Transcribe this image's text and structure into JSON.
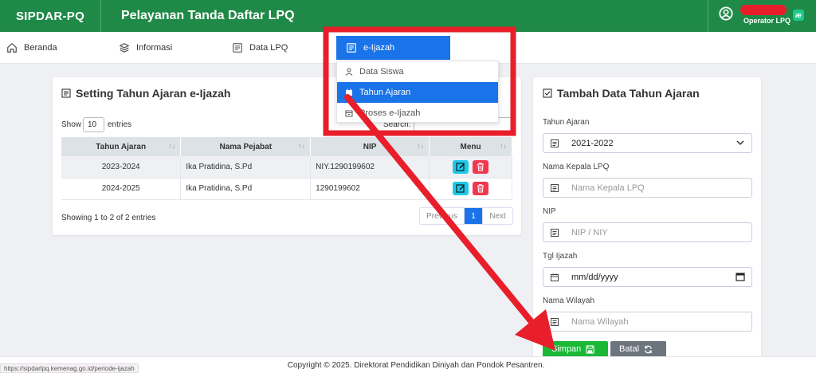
{
  "header": {
    "brand": "SIPDAR-PQ",
    "title": "Pelayanan Tanda Daftar LPQ",
    "user_role": "Operator LPQ",
    "badge": "æ"
  },
  "nav": {
    "items": [
      {
        "label": "Beranda",
        "icon": "home-icon"
      },
      {
        "label": "Informasi",
        "icon": "layers-icon"
      },
      {
        "label": "Data LPQ",
        "icon": "document-icon"
      }
    ]
  },
  "dropdown": {
    "header": "e-Ijazah",
    "items": [
      {
        "label": "Data Siswa",
        "icon": "person-icon"
      },
      {
        "label": "Tahun Ajaran",
        "icon": "calendar-icon"
      },
      {
        "label": "Proses e-Ijazah",
        "icon": "archive-icon"
      }
    ]
  },
  "settings": {
    "title": "Setting Tahun Ajaran e-Ijazah",
    "show_label": "Show",
    "show_value": "10",
    "entries_label": "entries",
    "search_label": "Search:",
    "columns": [
      "Tahun Ajaran",
      "Nama Pejabat",
      "NIP",
      "Menu"
    ],
    "rows": [
      {
        "tahun": "2023-2024",
        "pejabat": "Ika Pratidina, S.Pd",
        "nip": "NIY.1290199602"
      },
      {
        "tahun": "2024-2025",
        "pejabat": "Ika Pratidina, S.Pd",
        "nip": "1290199602"
      }
    ],
    "showing": "Showing 1 to 2 of 2 entries",
    "pager": {
      "prev": "Previous",
      "current": "1",
      "next": "Next"
    }
  },
  "form": {
    "title": "Tambah Data Tahun Ajaran",
    "tahun_label": "Tahun Ajaran",
    "tahun_value": "2021-2022",
    "kepala_label": "Nama Kepala LPQ",
    "kepala_placeholder": "Nama Kepala LPQ",
    "nip_label": "NIP",
    "nip_placeholder": "NIP / NIY",
    "tgl_label": "Tgl Ijazah",
    "tgl_placeholder": "mm/dd/yyyy",
    "wilayah_label": "Nama Wilayah",
    "wilayah_placeholder": "Nama Wilayah",
    "save_label": "Simpan",
    "cancel_label": "Batal"
  },
  "footer": {
    "text": "Copyright © 2025. Direktorat Pendidikan Diniyah dan Pondok Pesantren."
  },
  "status_url": "https://sipdarlpq.kemenag.go.id/periode-ijazah",
  "colors": {
    "header_green": "#1f8a47",
    "primary_blue": "#1a73e8",
    "annotation_red": "#e81e2a",
    "save_green": "#1bb838"
  }
}
